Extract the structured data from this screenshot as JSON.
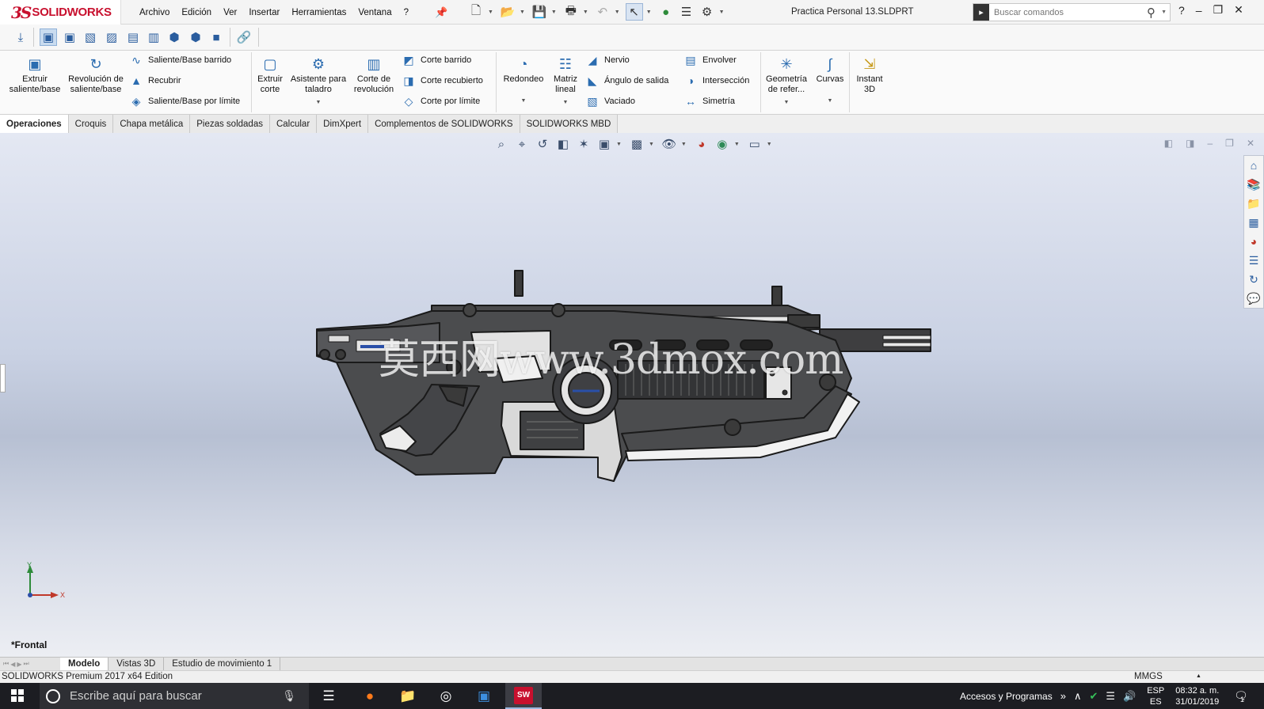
{
  "app": {
    "brand_prefix": "3S",
    "brand": "SOLIDWORKS",
    "document_title": "Practica Personal 13.SLDPRT"
  },
  "menu": [
    "Archivo",
    "Edición",
    "Ver",
    "Insertar",
    "Herramientas",
    "Ventana",
    "?"
  ],
  "search": {
    "placeholder": "Buscar comandos"
  },
  "features": {
    "extrude_boss": "Extruir saliente/base",
    "revolve_boss": "Revolución de saliente/base",
    "swept_boss": "Saliente/Base barrido",
    "loft_boss": "Recubrir",
    "boundary_boss": "Saliente/Base por límite",
    "extrude_cut": "Extruir corte",
    "hole_wizard": "Asistente para taladro",
    "revolve_cut": "Corte de revolución",
    "swept_cut": "Corte barrido",
    "loft_cut": "Corte recubierto",
    "boundary_cut": "Corte por límite",
    "fillet": "Redondeo",
    "linear_pattern": "Matriz lineal",
    "rib": "Nervio",
    "draft": "Ángulo de salida",
    "shell": "Vaciado",
    "wrap": "Envolver",
    "intersect": "Intersección",
    "mirror": "Simetría",
    "ref_geometry": "Geometría de refer...",
    "curves": "Curvas",
    "instant3d": "Instant 3D"
  },
  "cm_tabs": [
    "Operaciones",
    "Croquis",
    "Chapa metálica",
    "Piezas soldadas",
    "Calcular",
    "DimXpert",
    "Complementos de SOLIDWORKS",
    "SOLIDWORKS MBD"
  ],
  "viewport": {
    "view_name": "*Frontal",
    "watermark": "莫西网www.3dmox.com",
    "axis_y": "Y",
    "axis_x": "X"
  },
  "bottom_tabs": [
    "Modelo",
    "Vistas 3D",
    "Estudio de movimiento 1"
  ],
  "status": {
    "edition": "SOLIDWORKS Premium 2017 x64 Edition",
    "units": "MMGS"
  },
  "taskbar": {
    "search_placeholder": "Escribe aquí para buscar",
    "sw_badge": "SW",
    "tray_label": "Accesos y Programas",
    "lang_top": "ESP",
    "lang_bottom": "ES",
    "time": "08:32 a. m.",
    "date": "31/01/2019",
    "notification_count": "1"
  },
  "colors": {
    "brand_red": "#c8102e",
    "accent_blue": "#2b6cb0"
  }
}
